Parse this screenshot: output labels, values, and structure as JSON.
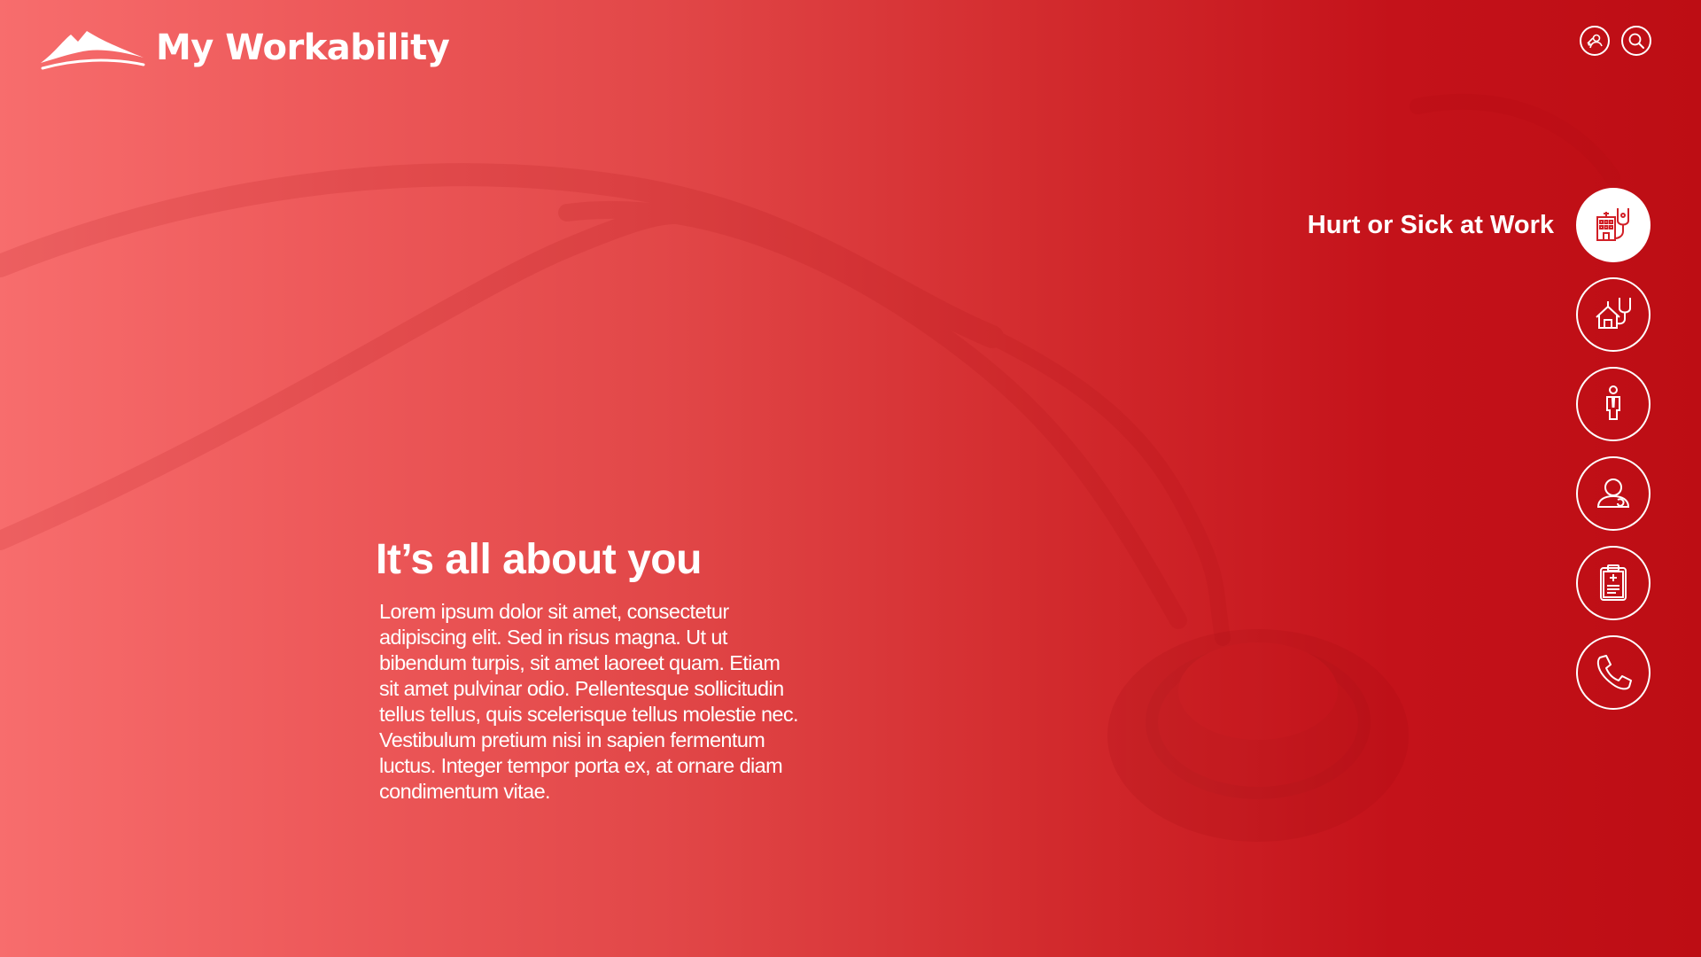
{
  "app": {
    "name": "My Workability"
  },
  "header": {
    "actions": [
      {
        "icon": "people-connect-icon"
      },
      {
        "icon": "search-icon"
      }
    ]
  },
  "hero": {
    "title": "It’s all about you",
    "body": "Lorem ipsum dolor sit amet, consectetur adipiscing elit. Sed in risus magna. Ut ut bibendum turpis, sit amet laoreet quam. Etiam sit amet pulvinar odio. Pellentesque sollicitudin tellus tellus, quis scelerisque tellus molestie nec. Vestibulum pretium nisi in sapien fermentum luctus. Integer tempor porta ex, at ornare diam condimentum vitae."
  },
  "side_nav": {
    "items": [
      {
        "label": "Hurt or Sick at Work",
        "icon": "hospital-stethoscope-icon",
        "active": true
      },
      {
        "label": "",
        "icon": "home-stethoscope-icon",
        "active": false
      },
      {
        "label": "",
        "icon": "worker-icon",
        "active": false
      },
      {
        "label": "",
        "icon": "person-support-icon",
        "active": false
      },
      {
        "label": "",
        "icon": "medical-clipboard-icon",
        "active": false
      },
      {
        "label": "",
        "icon": "phone-icon",
        "active": false
      }
    ]
  },
  "colors": {
    "gradient_start": "#f76d6d",
    "gradient_end": "#bd0d14",
    "foreground": "#ffffff",
    "active_icon": "#d11f26"
  }
}
